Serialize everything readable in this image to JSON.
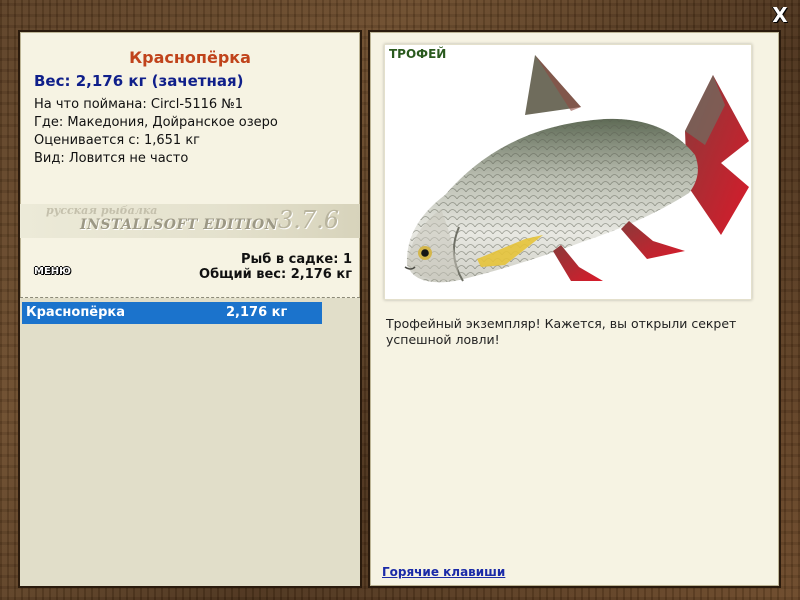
{
  "close_label": "X",
  "fish": {
    "name": "Краснопёрка",
    "weight_line": "Вес: 2,176 кг (зачетная)",
    "info": [
      "На что поймана: Circl-5116 №1",
      "Где: Македония, Дойранское озеро",
      "Оценивается с: 1,651 кг",
      "Вид: Ловится не часто"
    ]
  },
  "banner": {
    "small": "русская рыбалка",
    "big": "INSTALLSOFT EDITION",
    "version": "3.7.6"
  },
  "menu_label": "МЕНЮ",
  "summary": {
    "count_line": "Рыб в садке: 1",
    "total_line": "Общий вес: 2,176 кг"
  },
  "keepnet": [
    {
      "name": "Краснопёрка",
      "weight": "2,176 кг",
      "selected": true
    }
  ],
  "image": {
    "badge": "ТРОФЕЙ",
    "icon": "rudd-fish-picture"
  },
  "trophy_message": "Трофейный экземпляр! Кажется, вы открыли секрет успешной ловли!",
  "hotkeys_label": "Горячие клавиши",
  "colors": {
    "title": "#c0431b",
    "weight": "#0f1f8a",
    "selection": "#1b73cc",
    "link": "#1a2aa8",
    "panel": "#f6f3e3"
  }
}
